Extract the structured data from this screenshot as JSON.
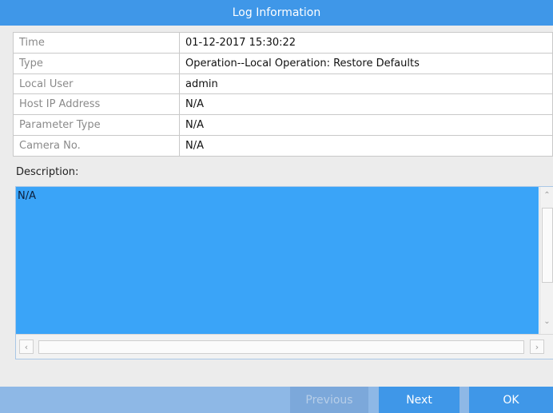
{
  "dialog": {
    "title": "Log Information"
  },
  "info": {
    "rows": [
      {
        "label": "Time",
        "value": "01-12-2017 15:30:22"
      },
      {
        "label": "Type",
        "value": "Operation--Local Operation: Restore Defaults"
      },
      {
        "label": "Local User",
        "value": "admin"
      },
      {
        "label": "Host IP Address",
        "value": "N/A"
      },
      {
        "label": "Parameter Type",
        "value": "N/A"
      },
      {
        "label": "Camera No.",
        "value": "N/A"
      }
    ]
  },
  "description": {
    "label": "Description:",
    "text": "N/A"
  },
  "buttons": {
    "previous": "Previous",
    "next": "Next",
    "ok": "OK"
  },
  "colors": {
    "accent": "#3f97e8",
    "selection": "#3aa4f8",
    "footer": "#8eb8e6"
  }
}
